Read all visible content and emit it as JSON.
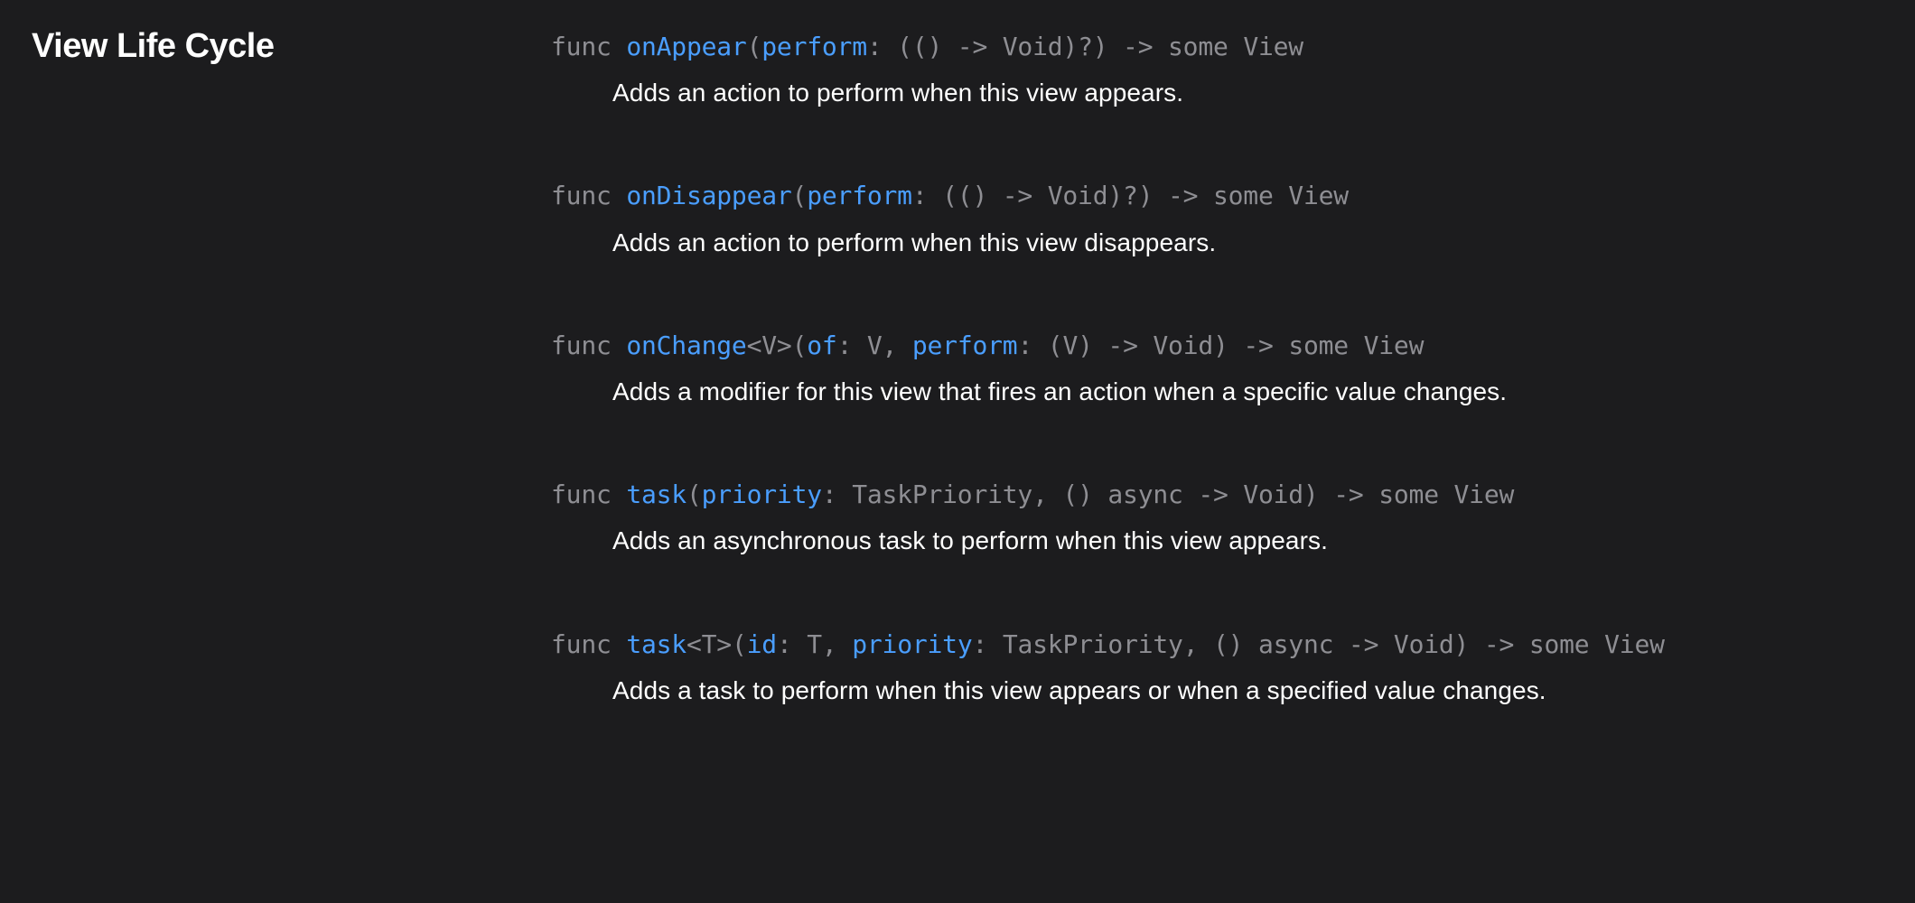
{
  "section": {
    "title": "View Life Cycle"
  },
  "items": [
    {
      "kw_func": "func",
      "name": "onAppear",
      "sig_open": "(",
      "label1": "perform",
      "rest": ": (() -> Void)?) -> ",
      "kw_some": "some",
      "ret_type": " View",
      "description": "Adds an action to perform when this view appears."
    },
    {
      "kw_func": "func",
      "name": "onDisappear",
      "sig_open": "(",
      "label1": "perform",
      "rest": ": (() -> Void)?) -> ",
      "kw_some": "some",
      "ret_type": " View",
      "description": "Adds an action to perform when this view disappears."
    },
    {
      "kw_func": "func",
      "name": "onChange",
      "generic": "<V>",
      "sig_open": "(",
      "label1": "of",
      "mid1": ": V, ",
      "label2": "perform",
      "rest": ": (V) -> Void) -> ",
      "kw_some": "some",
      "ret_type": " View",
      "description": "Adds a modifier for this view that fires an action when a specific value changes."
    },
    {
      "kw_func": "func",
      "name": "task",
      "sig_open": "(",
      "label1": "priority",
      "rest": ": TaskPriority, () async -> Void) -> ",
      "kw_some": "some",
      "ret_type": " View",
      "description": "Adds an asynchronous task to perform when this view appears."
    },
    {
      "kw_func": "func",
      "name": "task",
      "generic": "<T>",
      "sig_open": "(",
      "label1": "id",
      "mid1": ": T, ",
      "label2": "priority",
      "rest": ": TaskPriority, () async -> Void) -> ",
      "kw_some": "some",
      "ret_type": " View",
      "description": "Adds a task to perform when this view appears or when a specified value changes."
    }
  ]
}
